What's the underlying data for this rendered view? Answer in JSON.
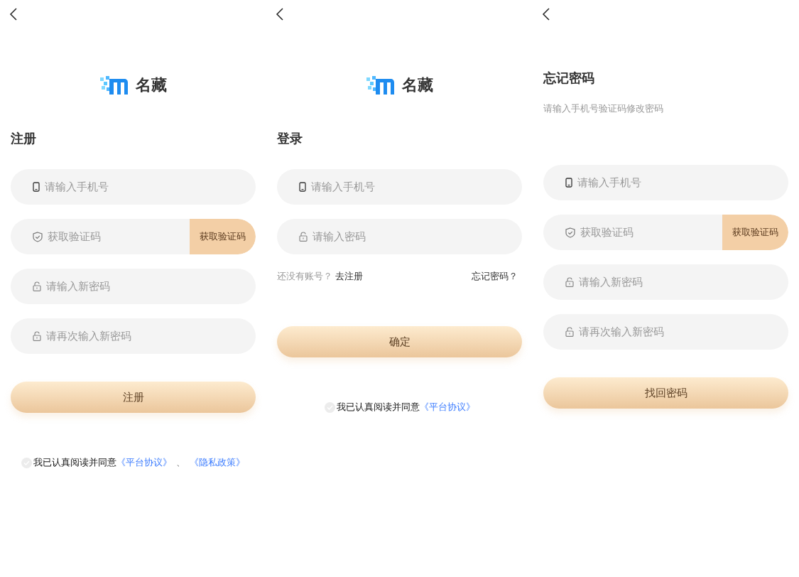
{
  "panels": [
    {
      "logo": {
        "name": "名藏"
      },
      "title": "注册",
      "fields": [
        {
          "kind": "phone",
          "placeholder": "请输入手机号"
        },
        {
          "kind": "code",
          "placeholder": "获取验证码",
          "button": "获取验证码"
        },
        {
          "kind": "password",
          "placeholder": "请输入新密码"
        },
        {
          "kind": "password",
          "placeholder": "请再次输入新密码"
        }
      ],
      "submit": "注册",
      "agreement": {
        "checked": false,
        "text": "我已认真阅读并同意",
        "links": [
          "《平台协议》",
          "《隐私政策》"
        ],
        "separator": "、"
      }
    },
    {
      "logo": {
        "name": "名藏"
      },
      "title": "登录",
      "fields": [
        {
          "kind": "phone",
          "placeholder": "请输入手机号"
        },
        {
          "kind": "password",
          "placeholder": "请输入密码"
        }
      ],
      "links_row": {
        "prompt": "还没有账号？",
        "register": "去注册",
        "forgot": "忘记密码？"
      },
      "submit": "确定",
      "agreement": {
        "checked": false,
        "text": "我已认真阅读并同意",
        "links": [
          "《平台协议》"
        ]
      }
    },
    {
      "title": "忘记密码",
      "subtitle": "请输入手机号验证码修改密码",
      "fields": [
        {
          "kind": "phone",
          "placeholder": "请输入手机号"
        },
        {
          "kind": "code",
          "placeholder": "获取验证码",
          "button": "获取验证码"
        },
        {
          "kind": "password",
          "placeholder": "请输入新密码"
        },
        {
          "kind": "password",
          "placeholder": "请再次输入新密码"
        }
      ],
      "submit": "找回密码"
    }
  ]
}
